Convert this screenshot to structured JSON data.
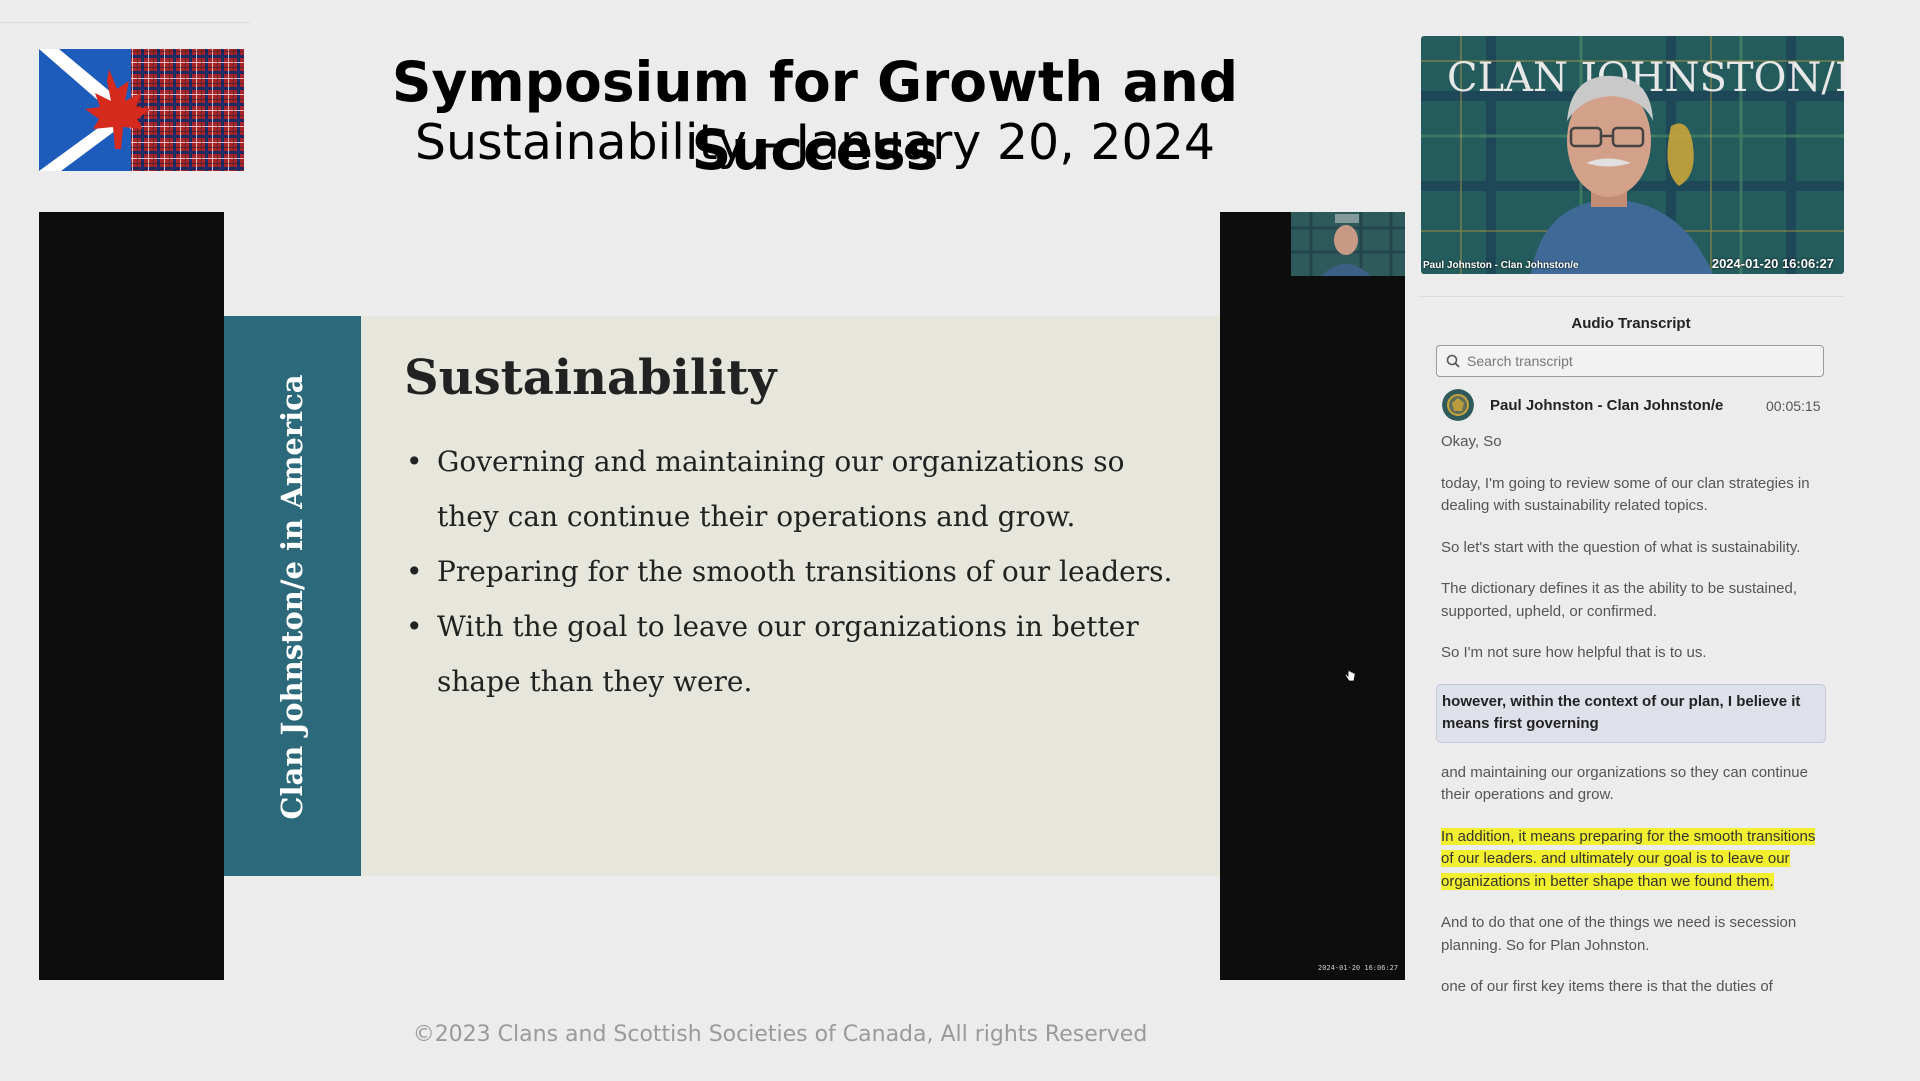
{
  "header": {
    "title": "Symposium for Growth and Success",
    "subtitle": "Sustainability - January 20, 2024"
  },
  "slide": {
    "vertical_text": "Clan Johnston/e in America",
    "heading": "Sustainability",
    "bullets": [
      "Governing and maintaining our organizations so they can continue their operations and grow.",
      "Preparing for the smooth transitions of our leaders.",
      "With the goal to leave our organizations in better shape than they were."
    ],
    "mini_timestamp": "2024-01-20 16:06:27"
  },
  "footer": {
    "copyright": "©2023 Clans and Scottish Societies of Canada, All rights Reserved"
  },
  "webcam": {
    "backdrop_text": "CLAN JOHNSTON/E",
    "name_label": "Paul Johnston - Clan Johnston/e",
    "timestamp": "2024-01-20 16:06:27"
  },
  "transcript": {
    "title": "Audio Transcript",
    "search_placeholder": "Search transcript",
    "speaker": "Paul Johnston - Clan Johnston/e",
    "speaker_time": "00:05:15",
    "segments": [
      "Okay, So",
      "today, I'm going to review some of our clan strategies in dealing with sustainability related topics.",
      "So let's start with the question of what is sustainability.",
      "The dictionary defines it as the ability to be sustained, supported, upheld, or confirmed.",
      "So I'm not sure how helpful that is to us.",
      "however, within the context of our plan, I believe it means first governing",
      "and maintaining our organizations so they can continue their operations and grow.",
      "In addition, it means preparing for the smooth transitions of our leaders. and ultimately our goal is to leave our organizations in better shape than we found them.",
      "And to do that one of the things we need is secession planning. So for Plan Johnston.",
      "one of our first key items there is that the duties of"
    ]
  },
  "colors": {
    "slide_teal": "#2c6a7b",
    "transcript_highlight": "#f2ef2e",
    "current_segment": "#dfe1ea"
  }
}
